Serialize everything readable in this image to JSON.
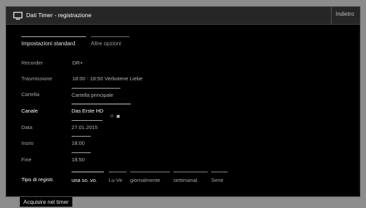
{
  "window": {
    "title": "Dati Timer - registrazione",
    "back_label": "Indietro"
  },
  "tabs": [
    {
      "label": "Impostazioni standard",
      "selected": true
    },
    {
      "label": "Altre opzioni",
      "selected": false
    }
  ],
  "form": {
    "recorder": {
      "label": "Recorder",
      "value": "DR+"
    },
    "trasmissione": {
      "label": "Trasmissione",
      "value": "18:00 - 18:50 Verbotene Liebe"
    },
    "cartella": {
      "label": "Cartella",
      "value": "Cartella principale"
    },
    "canale": {
      "label": "Canale",
      "value": "Das Erste HD"
    },
    "data": {
      "label": "Data",
      "value": "27.01.2015"
    },
    "inizio": {
      "label": "Inizio",
      "value": "18:00"
    },
    "fine": {
      "label": "Fine",
      "value": "18:50"
    },
    "tipo": {
      "label": "Tipo di registr.",
      "options": [
        "una so. vo.",
        "Lu-Ve",
        "giornalmente",
        "settimanal.",
        "Serie"
      ],
      "selected": "una so. vo."
    }
  },
  "footer": {
    "confirm_label": "Acquisire nel timer"
  },
  "colors": {
    "background": "#8c8c8c",
    "panel": "#000000",
    "titlebar": "#262626"
  }
}
